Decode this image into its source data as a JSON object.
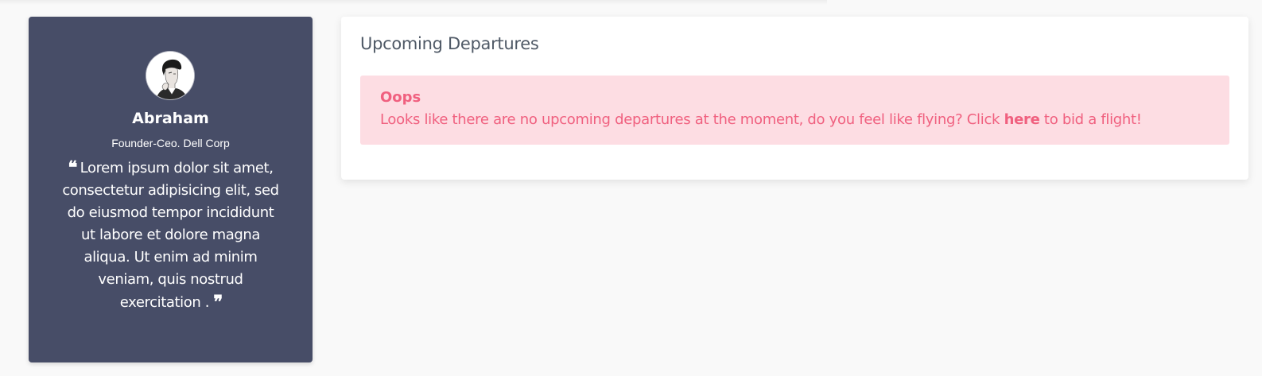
{
  "profile": {
    "avatar_icon": "person-portrait-icon",
    "name": "Abraham",
    "title": "Founder-Ceo. Dell Corp",
    "quote_open": "❝",
    "quote_text": "Lorem ipsum dolor sit amet, consectetur adipisicing elit, sed do eiusmod tempor incididunt ut labore et dolore magna aliqua. Ut enim ad minim veniam, quis nostrud exercitation .",
    "quote_close": "❞",
    "card_color": "#474d67"
  },
  "departures": {
    "title": "Upcoming Departures",
    "alert": {
      "heading": "Oops",
      "message_before": "Looks like there are no upcoming departures at the moment, do you feel like flying? Click ",
      "link_label": "here",
      "message_after": " to bid a flight!",
      "background_color": "#fddde3",
      "text_color": "#f0607f"
    }
  }
}
